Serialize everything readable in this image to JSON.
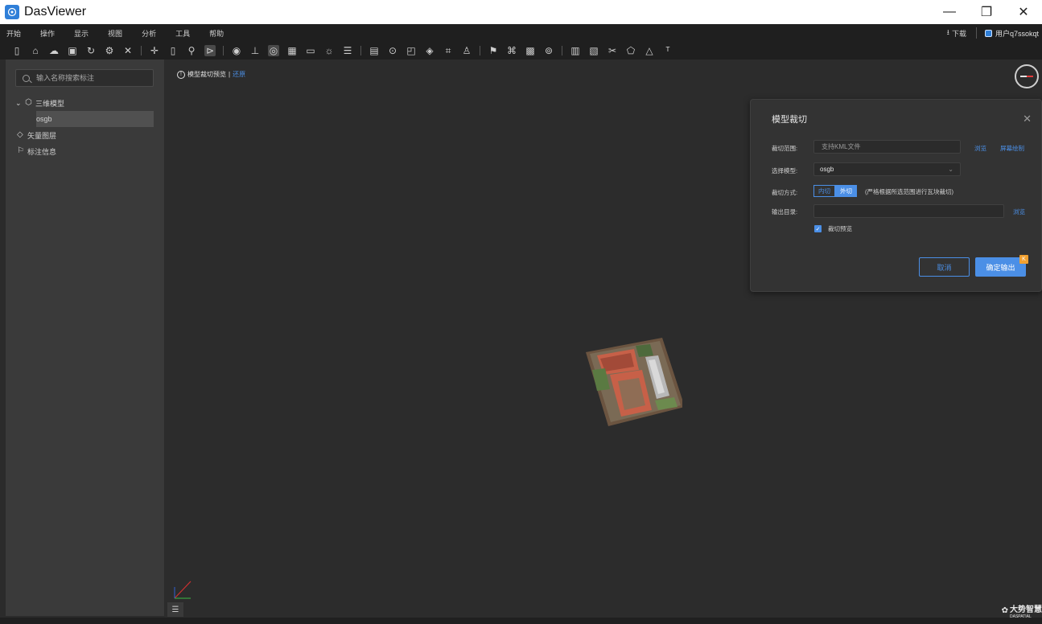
{
  "window": {
    "title": "DasViewer",
    "minimize": "—",
    "restore": "❐",
    "close": "✕"
  },
  "menu": {
    "items": [
      "开始",
      "操作",
      "显示",
      "视图",
      "分析",
      "工具",
      "帮助"
    ],
    "download_label": "下载",
    "user_label": "用户q7ssokqt"
  },
  "sidebar": {
    "search_placeholder": "输入名称搜索标注",
    "tree": {
      "model_group": "三维模型",
      "model_item": "osgb",
      "vector_layer": "矢量图层",
      "annotation_info": "标注信息"
    }
  },
  "viewport": {
    "preview_notice": "模型裁切预览",
    "restore_link": "还原"
  },
  "dialog": {
    "title": "模型裁切",
    "range_label": "裁切范围:",
    "range_placeholder": "支持KML文件",
    "browse_link": "浏览",
    "screen_draw_link": "屏幕绘制",
    "model_label": "选择模型:",
    "model_value": "osgb",
    "mode_label": "裁切方式:",
    "mode_inner": "内切",
    "mode_outer": "外切",
    "mode_note": "(严格根据所选范围进行瓦块裁切)",
    "output_label": "输出目录:",
    "output_browse": "浏览",
    "preview_checkbox": "裁切预览",
    "preview_checked": true,
    "cancel_button": "取消",
    "confirm_button": "确定输出"
  },
  "brand": {
    "name": "大势智慧",
    "sub": "DASPATIAL"
  },
  "colors": {
    "accent": "#4b8fe6",
    "panel": "#3a3a3a",
    "viewport": "#2c2c2c",
    "toolbar": "#1f1f1f"
  }
}
